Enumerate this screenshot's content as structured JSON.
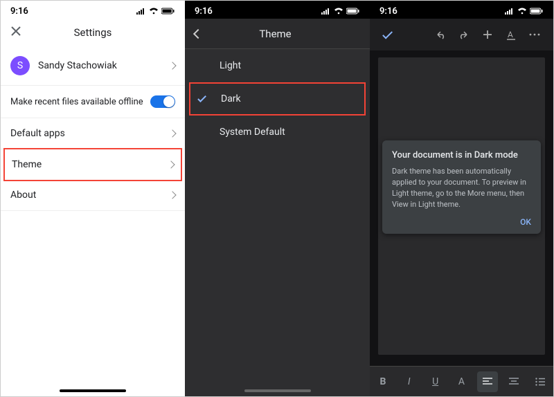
{
  "status": {
    "time": "9:16"
  },
  "panel1": {
    "title": "Settings",
    "profile": {
      "initial": "S",
      "name": "Sandy Stachowiak"
    },
    "offline": {
      "label": "Make recent files available offline",
      "on": true
    },
    "items": {
      "default_apps": "Default apps",
      "theme": "Theme",
      "about": "About"
    }
  },
  "panel2": {
    "title": "Theme",
    "options": {
      "light": "Light",
      "dark": "Dark",
      "system": "System Default"
    },
    "selected": "dark"
  },
  "panel3": {
    "dialog": {
      "title": "Your document is in Dark mode",
      "body": "Dark theme has been automatically applied to your document. To preview in Light theme, go to the More menu, then View in Light theme.",
      "ok": "OK"
    },
    "format": {
      "bold": "B",
      "italic": "I",
      "underline": "U",
      "font": "A"
    }
  }
}
